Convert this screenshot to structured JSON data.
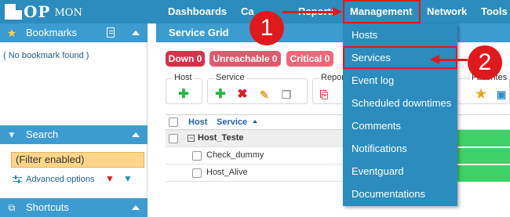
{
  "header": {
    "logo_main": "OP",
    "logo_sub": "MON",
    "nav": [
      "Dashboards",
      "Ca",
      "Reports",
      "Management",
      "Network",
      "Tools"
    ]
  },
  "sidebar": {
    "bookmarks_title": "Bookmarks",
    "no_bookmark": "( No bookmark found )",
    "search_title": "Search",
    "filter_text": "(Filter enabled)",
    "advanced_options": "Advanced options",
    "shortcuts_title": "Shortcuts"
  },
  "main": {
    "title": "Service Grid",
    "status_pills": [
      {
        "label": "Down 0",
        "color": "#d9304a"
      },
      {
        "label": "Unreachable 0",
        "color": "#e05a6e"
      },
      {
        "label": "Critical 0",
        "color": "#f0687a"
      }
    ],
    "groups": {
      "host": "Host",
      "service": "Service",
      "report": "Report",
      "favorites": "Favorites"
    },
    "table": {
      "col_host": "Host",
      "col_service": "Service",
      "host_row": "Host_Teste",
      "service_rows": [
        "Check_dummy",
        "Host_Alive"
      ]
    }
  },
  "management_menu": {
    "items": [
      "Hosts",
      "Services",
      "Event log",
      "Scheduled downtimes",
      "Comments",
      "Notifications",
      "Eventguard",
      "Documentations"
    ],
    "highlighted": "Services"
  },
  "callouts": {
    "one": "1",
    "two": "2"
  },
  "colors": {
    "brand": "#2b8cbd",
    "accent": "#e0191f",
    "ok": "#3fd067"
  },
  "icons": {
    "bookmarks": "star-icon",
    "search": "funnel-icon",
    "shortcuts": "link-icon",
    "add": "plus-icon",
    "delete": "x-icon",
    "edit": "pencil-icon",
    "copy": "copy-icon",
    "pdf": "pdf-icon"
  }
}
